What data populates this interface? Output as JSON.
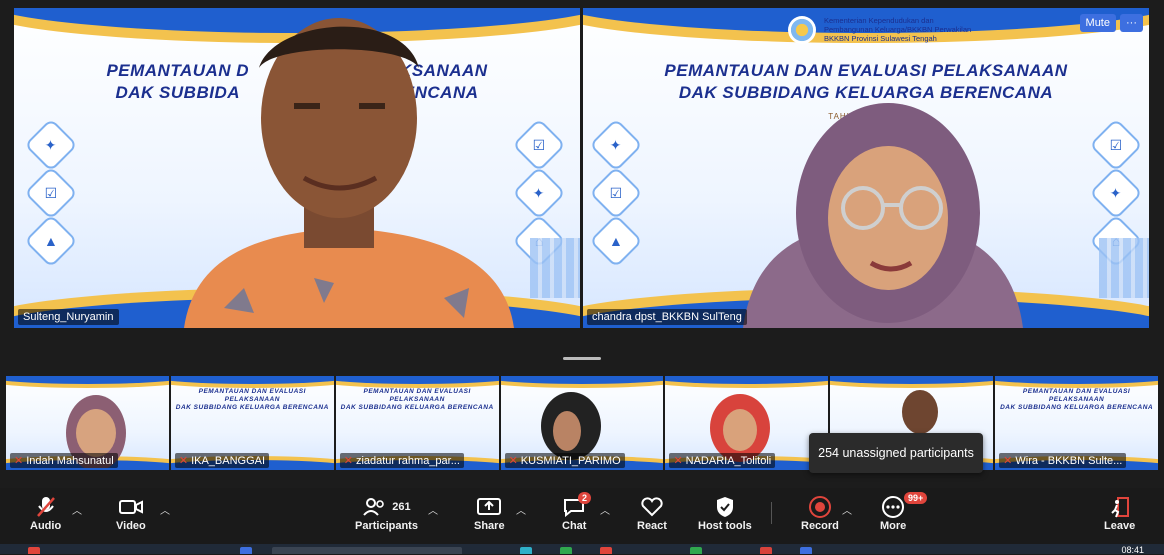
{
  "tiles": {
    "main1": {
      "name": "Sulteng_Nuryamin",
      "slide_title_line1": "PEMANTAUAN D",
      "slide_title_line1b": "KSANAAN",
      "slide_title_line2": "DAK SUBBIDA",
      "slide_title_line2b": "RENCANA"
    },
    "main2": {
      "name": "chandra dpst_BKKBN SulTeng",
      "slide_title_line1": "PEMANTAUAN DAN EVALUASI PELAKSANAAN",
      "slide_title_line2": "DAK SUBBIDANG KELUARGA BERENCANA",
      "subtitle": "TAHUN ANGGAR",
      "logo_text": "Kementerian Kependudukan dan Pembangunan Keluarga/BKKBN Perwakilan BKKBN Provinsi Sulawesi Tengah",
      "mute_label": "Mute",
      "more_label": "···"
    }
  },
  "strip": [
    {
      "name": "Indah Mahsunatul"
    },
    {
      "name": "IKA_BANGGAI"
    },
    {
      "name": "ziadatur rahma_par..."
    },
    {
      "name": "KUSMIATI_PARIMO"
    },
    {
      "name": "NADARIA_Tolitoli"
    },
    {
      "name": ""
    },
    {
      "name": "Wira - BKKBN Sulte..."
    }
  ],
  "tooltip": "254 unassigned participants",
  "toolbar": {
    "audio": "Audio",
    "video": "Video",
    "participants": "Participants",
    "participants_count": "261",
    "share": "Share",
    "chat": "Chat",
    "chat_badge": "2",
    "react": "React",
    "host_tools": "Host tools",
    "record": "Record",
    "more": "More",
    "more_badge": "99+",
    "leave": "Leave"
  },
  "clock": "08:41",
  "colors": {
    "accent": "#2fcf5a",
    "brand": "#1f5fcf",
    "danger": "#e0453c"
  }
}
